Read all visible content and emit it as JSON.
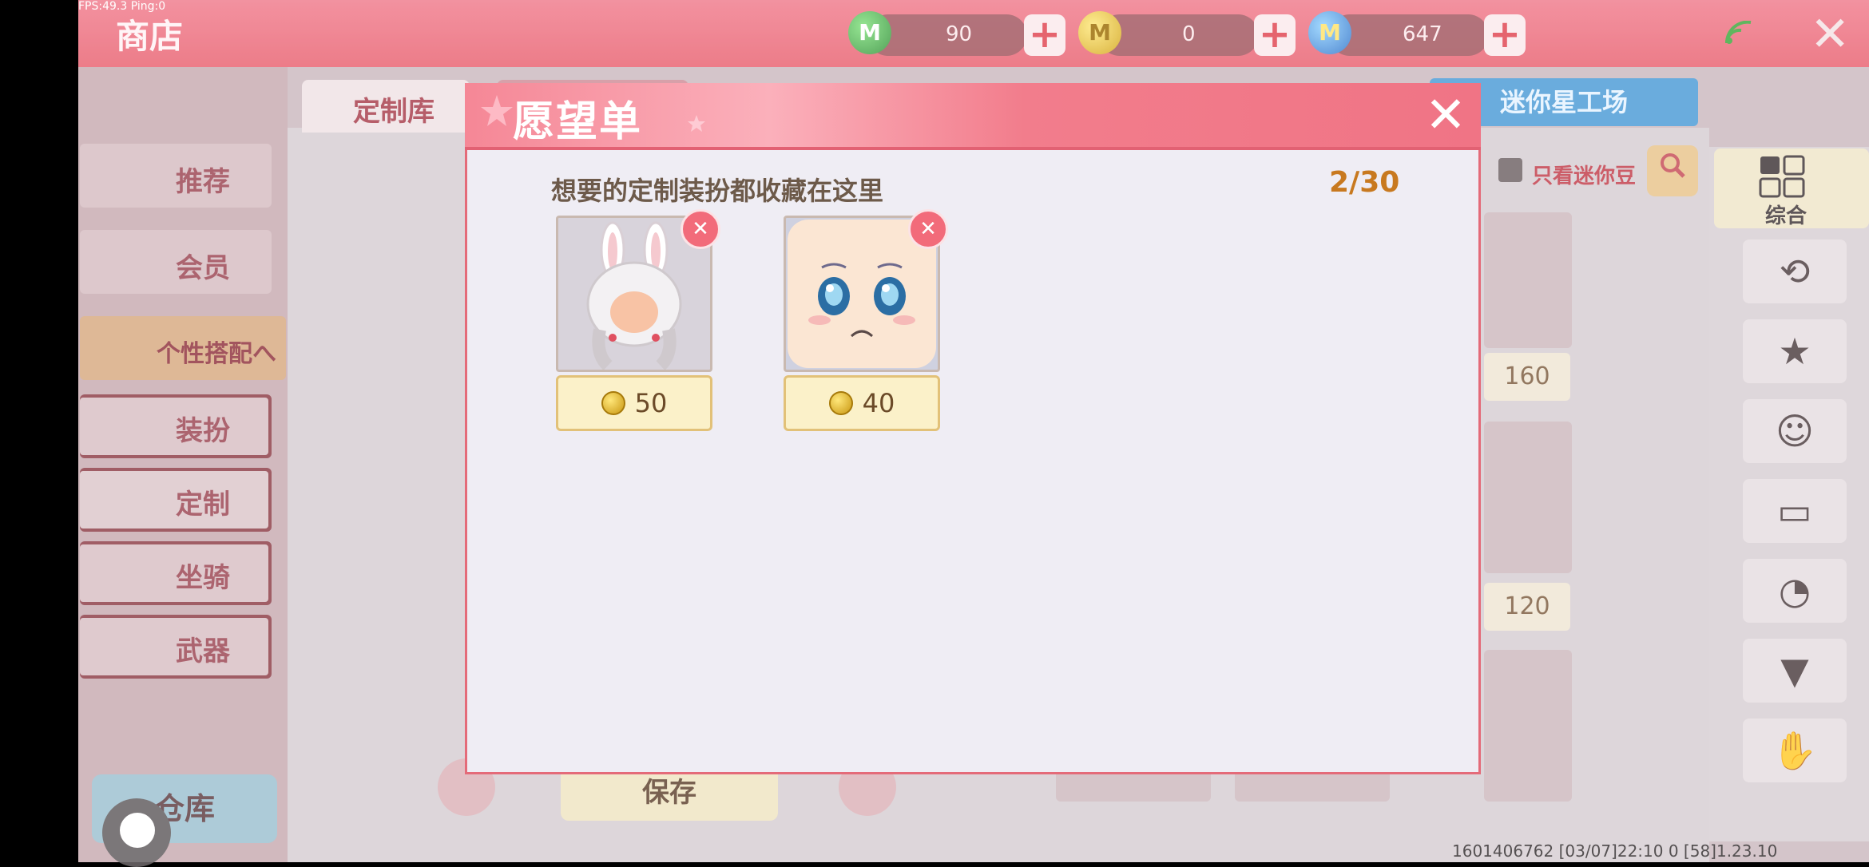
{
  "debug": {
    "fps_text": "FPS:49.3  Ping:0"
  },
  "topbar": {
    "title": "商店",
    "currencies": [
      {
        "name": "green-coin",
        "icon_letter": "M",
        "value": "90"
      },
      {
        "name": "gold-coin",
        "icon_letter": "M",
        "value": "0"
      },
      {
        "name": "blue-coin",
        "icon_letter": "M",
        "value": "647"
      }
    ],
    "plus_symbol": "+",
    "close_symbol": "✕",
    "wifi_icon": "wifi-icon"
  },
  "tabs": {
    "custom_library": "定制库",
    "mini_workshop": "迷你星工场"
  },
  "sidebar": {
    "items": [
      {
        "label": "推荐"
      },
      {
        "label": "会员"
      },
      {
        "label": "个性搭配へ"
      },
      {
        "label": "装扮"
      },
      {
        "label": "定制"
      },
      {
        "label": "坐骑"
      },
      {
        "label": "武器"
      }
    ],
    "warehouse": "仓库"
  },
  "filters": {
    "only_mini_beans": "只看迷你豆",
    "composite": "综合"
  },
  "grid_prices": [
    "160",
    "120"
  ],
  "bottom": {
    "save": "保存"
  },
  "footer": {
    "build_info": "1601406762   [03/07]22:10 0  [58]1.23.10"
  },
  "modal": {
    "title": "愿望单",
    "subtitle": "想要的定制装扮都收藏在这里",
    "count": "2/30",
    "close_symbol": "✕",
    "items": [
      {
        "price": "50",
        "remove_symbol": "✕"
      },
      {
        "price": "40",
        "remove_symbol": "✕"
      }
    ]
  }
}
